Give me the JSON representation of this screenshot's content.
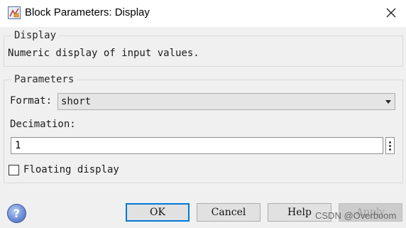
{
  "window": {
    "title": "Block Parameters: Display",
    "icon": "simulink-block-icon",
    "close_icon": "close-icon"
  },
  "description_group": {
    "legend": "Display",
    "text": "Numeric display of input values."
  },
  "parameters_group": {
    "legend": "Parameters",
    "format_label": "Format:",
    "format_value": "short",
    "decimation_label": "Decimation:",
    "decimation_value": "1",
    "floating_label": "Floating display",
    "floating_checked": false
  },
  "buttons": {
    "ok": "OK",
    "cancel": "Cancel",
    "help": "Help",
    "apply": "Apply"
  },
  "watermark": "CSDN @Overboom",
  "colors": {
    "primary_border": "#0078d7",
    "help_icon": "#6f8fd7"
  }
}
